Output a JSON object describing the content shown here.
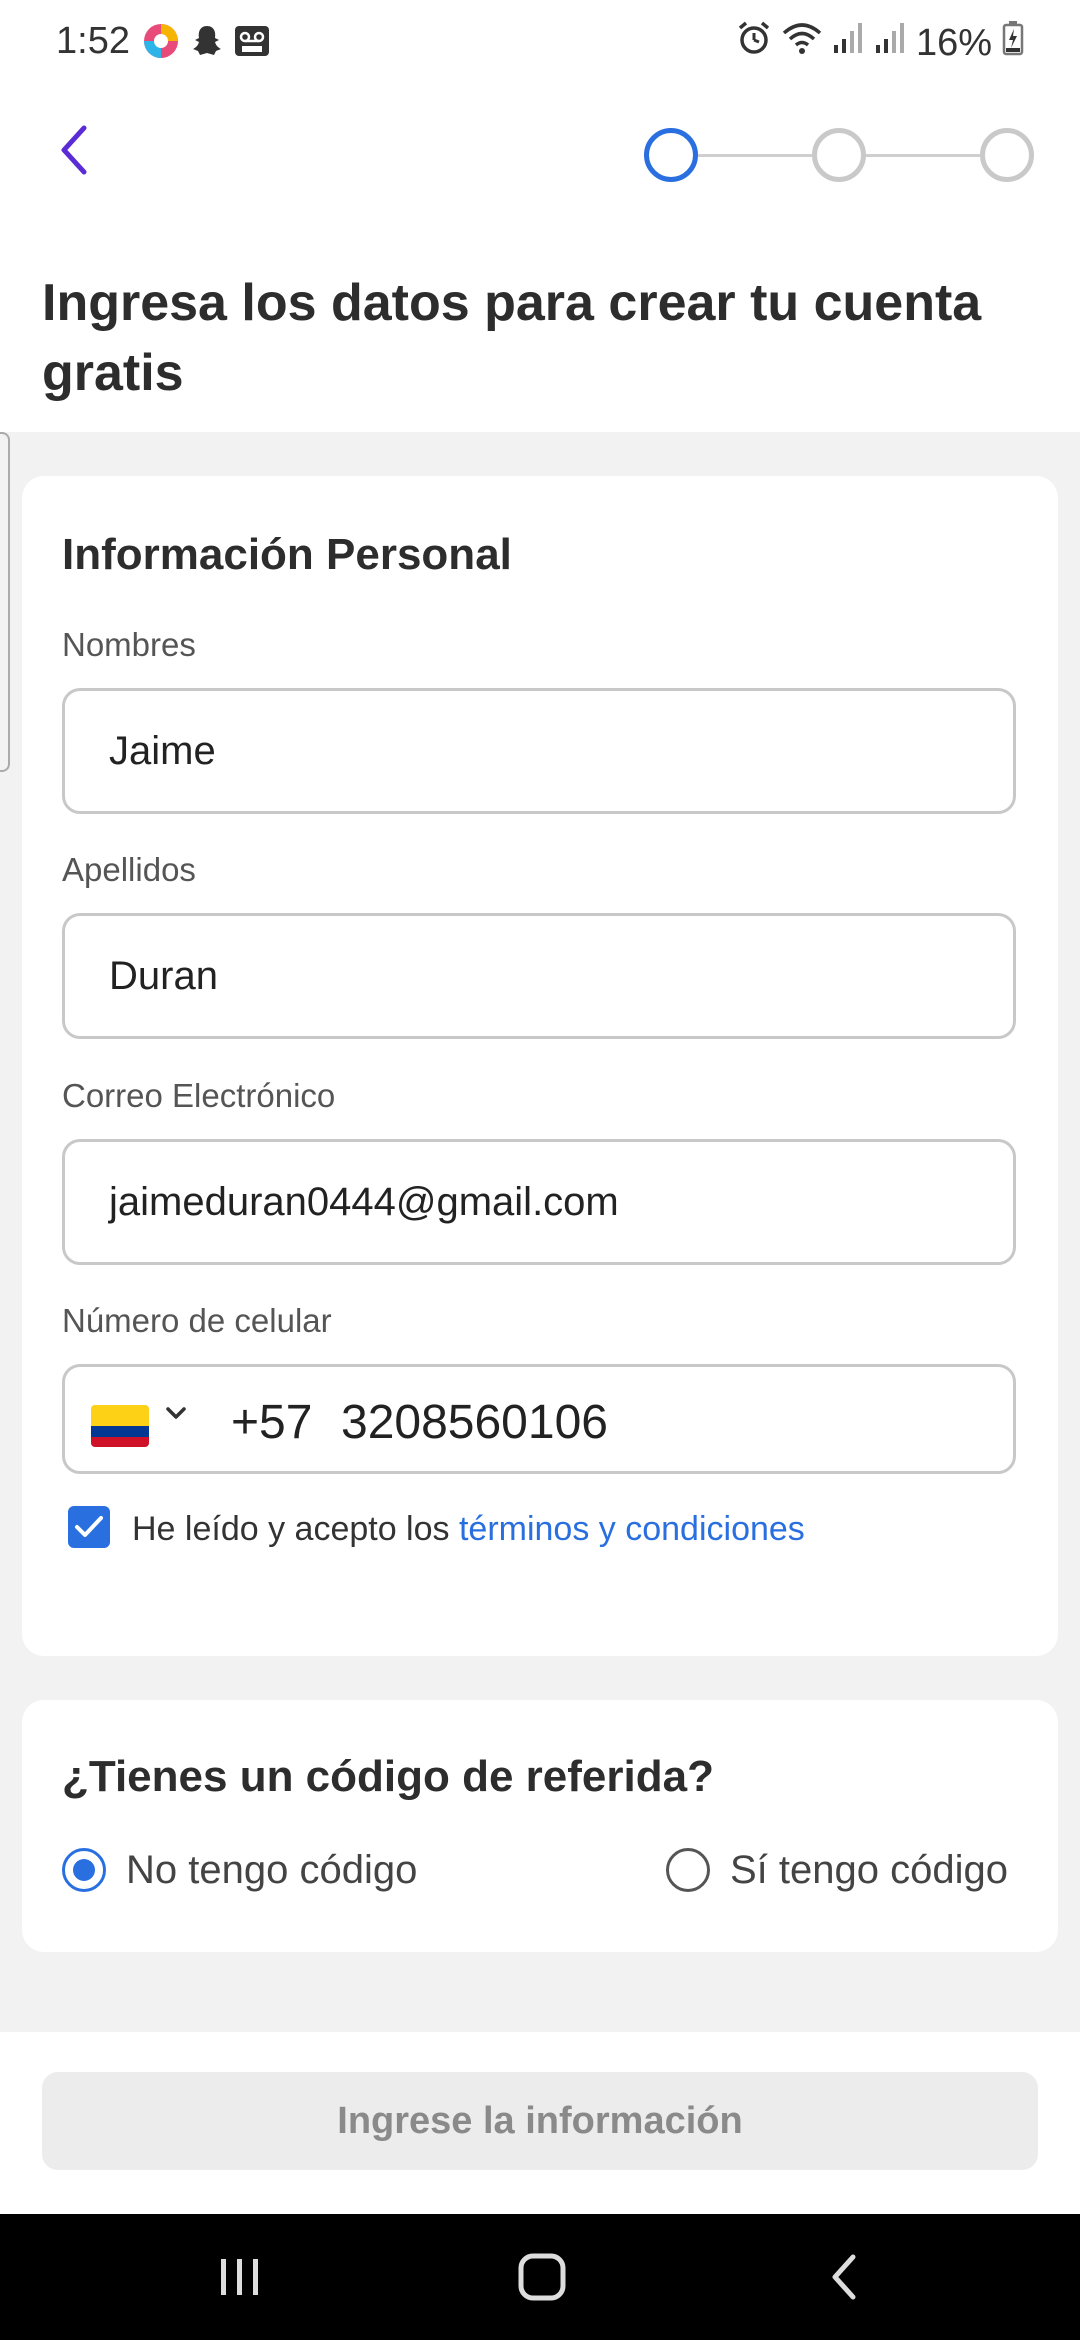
{
  "status_bar": {
    "time": "1:52",
    "battery": "16%",
    "left_icons": [
      "browser-icon",
      "snapchat-icon",
      "voicemail-icon"
    ],
    "right_icons": [
      "alarm-icon",
      "wifi-icon",
      "signal-icon",
      "signal-icon",
      "battery-icon"
    ]
  },
  "header": {
    "back_icon": "chevron-left-icon",
    "steps": {
      "total": 3,
      "current": 1
    }
  },
  "page_title": "Ingresa los datos para crear tu cuenta gratis",
  "personal_info": {
    "title": "Información Personal",
    "first_name": {
      "label": "Nombres",
      "value": "Jaime"
    },
    "last_name": {
      "label": "Apellidos",
      "value": "Duran"
    },
    "email": {
      "label": "Correo Electrónico",
      "value": "jaimeduran0444@gmail.com"
    },
    "phone": {
      "label": "Número de celular",
      "country_flag": "colombia-flag-icon",
      "country_code": "+57",
      "value": "3208560106"
    },
    "terms": {
      "checked": true,
      "text": "He leído y acepto los ",
      "link_text": "términos y condiciones"
    }
  },
  "referral": {
    "title": "¿Tienes un código de referida?",
    "options": [
      {
        "label": "No tengo código",
        "selected": true
      },
      {
        "label": "Sí tengo código",
        "selected": false
      }
    ]
  },
  "submit_button": {
    "label": "Ingrese la información",
    "enabled": false
  },
  "colors": {
    "accent": "#2a6fe0",
    "back_arrow": "#5b2bd6",
    "disabled_button_bg": "#ececec",
    "disabled_button_text": "#8a8a8a"
  },
  "nav_bar": {
    "buttons": [
      "recent-apps-icon",
      "home-icon",
      "back-icon"
    ]
  }
}
